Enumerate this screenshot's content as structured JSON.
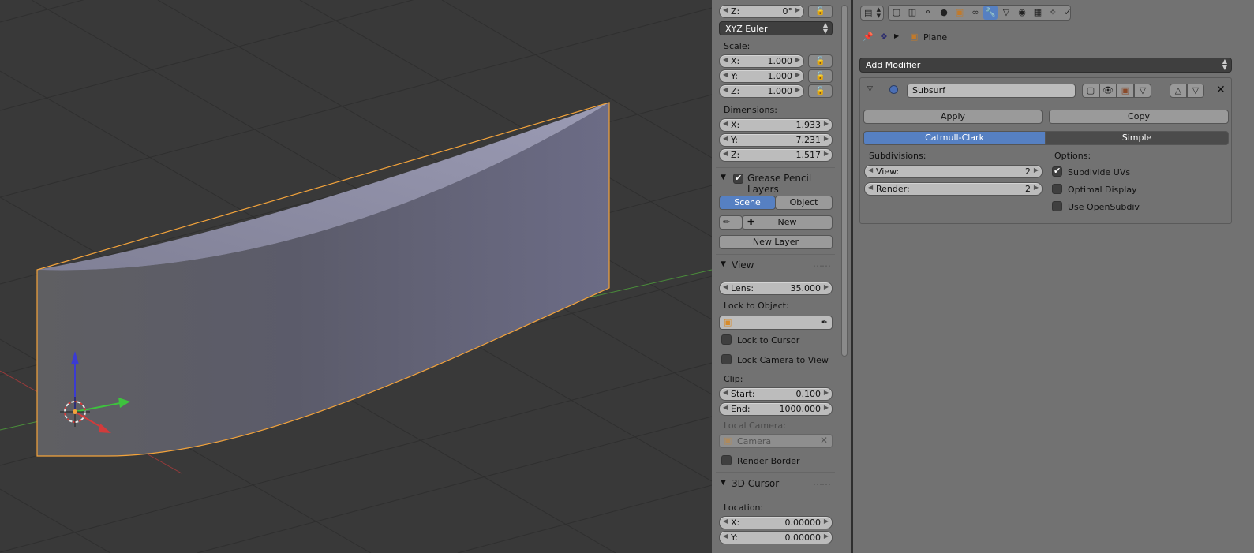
{
  "viewport": {
    "accent": "#f3a33b",
    "object_color": "#6e6e86",
    "axis_x_color": "#d23b3b",
    "axis_y_color": "#3ec23e",
    "axis_z_color": "#3b3bd2"
  },
  "npanel": {
    "rotation_z": {
      "label": "Z:",
      "value": "0°"
    },
    "rotation_mode": "XYZ Euler",
    "scale_label": "Scale:",
    "scale": [
      {
        "label": "X:",
        "value": "1.000"
      },
      {
        "label": "Y:",
        "value": "1.000"
      },
      {
        "label": "Z:",
        "value": "1.000"
      }
    ],
    "dimensions_label": "Dimensions:",
    "dimensions": [
      {
        "label": "X:",
        "value": "1.933"
      },
      {
        "label": "Y:",
        "value": "7.231"
      },
      {
        "label": "Z:",
        "value": "1.517"
      }
    ],
    "grease_pencil": {
      "title": "Grease Pencil Layers",
      "tab_scene": "Scene",
      "tab_object": "Object",
      "new_label": "New",
      "new_layer_label": "New Layer"
    },
    "view": {
      "title": "View",
      "lens": {
        "label": "Lens:",
        "value": "35.000"
      },
      "lock_to_object_label": "Lock to Object:",
      "lock_to_cursor": "Lock to Cursor",
      "lock_camera_to_view": "Lock Camera to View",
      "clip_label": "Clip:",
      "clip_start": {
        "label": "Start:",
        "value": "0.100"
      },
      "clip_end": {
        "label": "End:",
        "value": "1000.000"
      },
      "local_camera_label": "Local Camera:",
      "local_camera_value": "Camera",
      "render_border": "Render Border"
    },
    "cursor": {
      "title": "3D Cursor",
      "location_label": "Location:",
      "x": {
        "label": "X:",
        "value": "0.00000"
      },
      "y": {
        "label": "Y:",
        "value": "0.00000"
      }
    }
  },
  "props": {
    "breadcrumb_object": "Plane",
    "add_modifier": "Add Modifier",
    "modifier": {
      "name": "Subsurf",
      "apply": "Apply",
      "copy": "Copy",
      "type_catmull": "Catmull-Clark",
      "type_simple": "Simple",
      "subdivisions_label": "Subdivisions:",
      "view": {
        "label": "View:",
        "value": "2"
      },
      "render": {
        "label": "Render:",
        "value": "2"
      },
      "options_label": "Options:",
      "subdivide_uvs": "Subdivide UVs",
      "optimal_display": "Optimal Display",
      "use_opensubdiv": "Use OpenSubdiv"
    }
  }
}
